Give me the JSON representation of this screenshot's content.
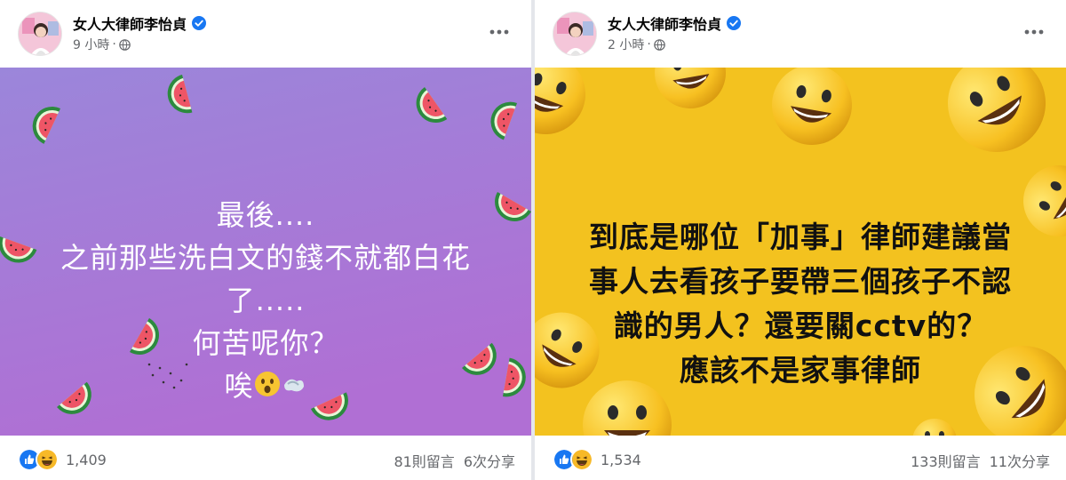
{
  "posts": [
    {
      "author": "女人大律師李怡貞",
      "time": "9 小時",
      "time_sep": "·",
      "text": "最後....\n之前那些洗白文的錢不就都白花\n了.....\n何苦呢你？\n唉",
      "reactions_count": "1,409",
      "comments": "81則留言",
      "shares": "6次分享",
      "background_color": "#9b7fd6"
    },
    {
      "author": "女人大律師李怡貞",
      "time": "2 小時",
      "time_sep": "·",
      "text": "到底是哪位「加事」律師建議當\n事人去看孩子要帶三個孩子不認\n識的男人？還要關cctv的？\n應該不是家事律師",
      "reactions_count": "1,534",
      "comments": "133則留言",
      "shares": "11次分享",
      "background_color": "#f3c21f"
    }
  ],
  "icons": {
    "verified": "verified-badge-icon",
    "globe": "globe-icon",
    "more": "more-options-icon",
    "like": "like-reaction-icon",
    "haha": "haha-reaction-icon"
  },
  "colors": {
    "facebook_blue": "#1877f2",
    "reaction_yellow": "#f7b928",
    "secondary_text": "#65676b"
  }
}
